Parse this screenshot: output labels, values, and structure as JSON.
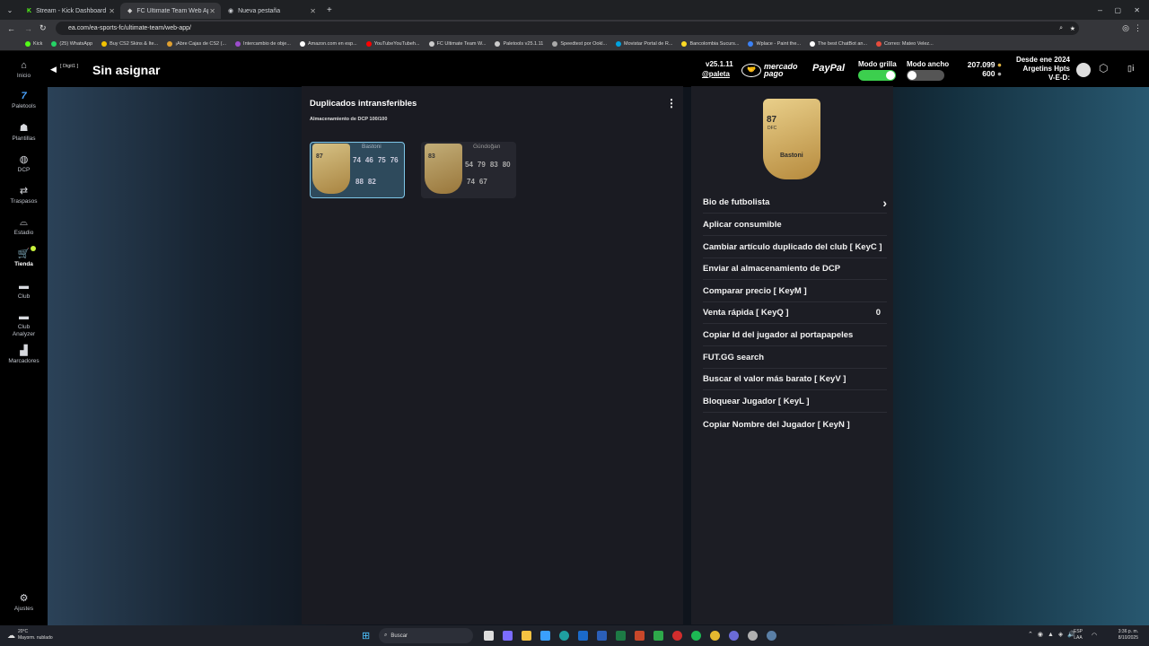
{
  "browser": {
    "tabs": [
      {
        "title": "Stream - Kick Dashboard"
      },
      {
        "title": "FC Ultimate Team Web App - l..."
      },
      {
        "title": "Nueva pestaña"
      }
    ],
    "url": "ea.com/ea-sports-fc/ultimate-team/web-app/",
    "bookmarks": [
      "Kick",
      "(25) WhatsApp",
      "Buy CS2 Skins & Ite...",
      "¡Abre Cajas de CS2 (...",
      "Intercambio de obje...",
      "Amazon.com en esp...",
      "YouTubeYouTubeh...",
      "FC Ultimate Team W...",
      "Paletools v25.1.11",
      "Speedtest por Ookl...",
      "Movistar Portal de R...",
      "Bancolombia Sucurs...",
      "Wplace - Paint the...",
      "The best ChatBot an...",
      "Correo: Mateo Velez..."
    ]
  },
  "sidebar": {
    "items": [
      {
        "label": "Inicio",
        "icon": "home-icon"
      },
      {
        "label": "Paletools",
        "icon": "paletools-icon"
      },
      {
        "label": "Plantillas",
        "icon": "squad-icon"
      },
      {
        "label": "DCP",
        "icon": "sbc-icon"
      },
      {
        "label": "Traspasos",
        "icon": "transfers-icon"
      },
      {
        "label": "Estadio",
        "icon": "stadium-icon"
      },
      {
        "label": "Tienda",
        "icon": "store-icon"
      },
      {
        "label": "Club",
        "icon": "club-icon"
      },
      {
        "label": "Club Analyzer",
        "icon": "analyzer-icon"
      },
      {
        "label": "Marcadores",
        "icon": "leaderboard-icon"
      }
    ],
    "settings_label": "Ajustes"
  },
  "header": {
    "back_tag": "[ Digit1 ]",
    "title": "Sin asignar",
    "version": "v25.1.11",
    "user": "@paleta",
    "mercado": "mercado",
    "pago": "pago",
    "paypal": "PayPal",
    "grid_mode_label": "Modo grilla",
    "wide_mode_label": "Modo ancho",
    "coins": "207.099",
    "points": "600",
    "since": "Desde ene 2024",
    "club_name": "Argetins Hpts",
    "record": "V-E-D:"
  },
  "list": {
    "title": "Duplicados intransferibles",
    "subtitle": "Almacenamiento de DCP 100/100",
    "cards": [
      {
        "name": "Bastoni",
        "rating": "87",
        "pos": "DFC",
        "stats_top": [
          "74",
          "46",
          "75",
          "76"
        ],
        "stats_bottom": [
          "88",
          "82"
        ],
        "headers_top": [
          "RIT",
          "TIR",
          "PAS",
          "REG"
        ],
        "headers_bottom": [
          "DEF",
          "FIS"
        ]
      },
      {
        "name": "Gündoğan",
        "rating": "83",
        "pos": "MC",
        "stats_top": [
          "54",
          "79",
          "83",
          "80"
        ],
        "stats_bottom": [
          "74",
          "67"
        ],
        "headers_top": [
          "RIT",
          "TIR",
          "PAS",
          "REG"
        ],
        "headers_bottom": [
          "DEF",
          "FIS"
        ]
      }
    ]
  },
  "detail": {
    "card": {
      "name": "Bastoni",
      "rating": "87",
      "pos": "DFC"
    },
    "menu": [
      {
        "label": "Bio de futbolista",
        "extra": "›"
      },
      {
        "label": "Aplicar consumible",
        "extra": ""
      },
      {
        "label": "Cambiar artículo duplicado del club [ KeyC ]",
        "extra": ""
      },
      {
        "label": "Enviar al almacenamiento de DCP",
        "extra": ""
      },
      {
        "label": "Comparar precio [ KeyM ]",
        "extra": ""
      },
      {
        "label": "Venta rápida [ KeyQ ]",
        "extra": "0"
      },
      {
        "label": "Copiar Id del jugador al portapapeles",
        "extra": ""
      },
      {
        "label": "FUT.GG search",
        "extra": ""
      },
      {
        "label": "Buscar el valor más barato [ KeyV ]",
        "extra": ""
      },
      {
        "label": "Bloquear Jugador [ KeyL ]",
        "extra": ""
      },
      {
        "label": "Copiar Nombre del Jugador [ KeyN ]",
        "extra": ""
      }
    ]
  },
  "taskbar": {
    "weather_temp": "20°C",
    "weather_desc": "Mayorm. nublado",
    "search_placeholder": "Buscar",
    "lang": "ESP",
    "lang2": "LAA",
    "time": "3:36 p. m.",
    "date": "8/10/2025"
  }
}
